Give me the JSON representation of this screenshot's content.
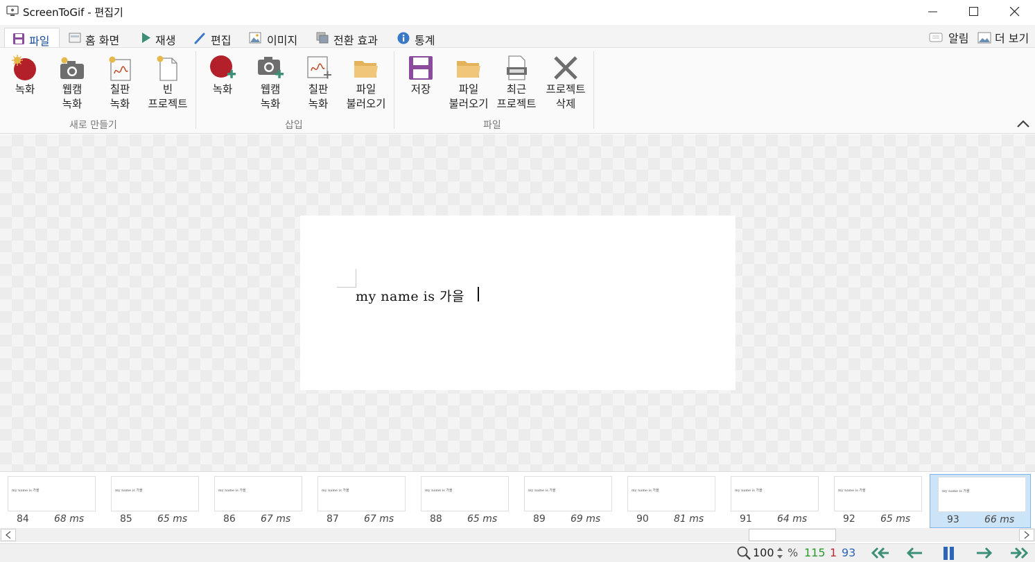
{
  "window": {
    "title": "ScreenToGif - 편집기",
    "minimize_icon": "minimize-icon",
    "maximize_icon": "maximize-icon",
    "close_icon": "close-icon"
  },
  "tabs": [
    {
      "label": "파일",
      "icon": "floppy-icon",
      "active": true
    },
    {
      "label": "홈 화면",
      "icon": "home-icon",
      "active": false
    },
    {
      "label": "재생",
      "icon": "play-icon",
      "active": false
    },
    {
      "label": "편집",
      "icon": "pencil-icon",
      "active": false
    },
    {
      "label": "이미지",
      "icon": "image-icon",
      "active": false
    },
    {
      "label": "전환 효과",
      "icon": "transition-icon",
      "active": false
    },
    {
      "label": "통계",
      "icon": "info-icon",
      "active": false
    }
  ],
  "right_links": {
    "notifications": "알림",
    "more": "더 보기"
  },
  "ribbon": {
    "groups": [
      {
        "label": "새로 만들기",
        "buttons": [
          {
            "label": "녹화",
            "icon": "record-icon"
          },
          {
            "label": "웹캠\n녹화",
            "icon": "webcam-icon"
          },
          {
            "label": "칠판\n녹화",
            "icon": "board-icon"
          },
          {
            "label": "빈\n프로젝트",
            "icon": "blank-project-icon"
          }
        ]
      },
      {
        "label": "삽입",
        "buttons": [
          {
            "label": "녹화",
            "icon": "record-add-icon"
          },
          {
            "label": "웹캠\n녹화",
            "icon": "webcam-add-icon"
          },
          {
            "label": "칠판\n녹화",
            "icon": "board-add-icon"
          },
          {
            "label": "파일\n불러오기",
            "icon": "folder-icon"
          }
        ]
      },
      {
        "label": "파일",
        "buttons": [
          {
            "label": "저장",
            "icon": "save-icon"
          },
          {
            "label": "파일\n불러오기",
            "icon": "folder-icon"
          },
          {
            "label": "최근\n프로젝트",
            "icon": "recent-projects-icon"
          },
          {
            "label": "프로젝트\n삭제",
            "icon": "delete-project-icon"
          }
        ]
      }
    ],
    "collapse_icon": "chevron-up-icon"
  },
  "canvas": {
    "frame_text": "my name is 가을"
  },
  "frames": [
    {
      "number": "84",
      "delay": "68 ms",
      "text": "my name is 가을"
    },
    {
      "number": "85",
      "delay": "65 ms",
      "text": "my name is 가을"
    },
    {
      "number": "86",
      "delay": "67 ms",
      "text": "my name is 가을"
    },
    {
      "number": "87",
      "delay": "67 ms",
      "text": "my name is 가을"
    },
    {
      "number": "88",
      "delay": "65 ms",
      "text": "my name is 가을"
    },
    {
      "number": "89",
      "delay": "69 ms",
      "text": "my name is 가을"
    },
    {
      "number": "90",
      "delay": "81 ms",
      "text": "my name is 가을"
    },
    {
      "number": "91",
      "delay": "64 ms",
      "text": "my name is 가을"
    },
    {
      "number": "92",
      "delay": "65 ms",
      "text": "my name is 가을"
    },
    {
      "number": "93",
      "delay": "66 ms",
      "text": "my name is 가을",
      "selected": true
    }
  ],
  "status": {
    "zoom": "100",
    "zoom_unit": "%",
    "total_frames": "115",
    "selected_count": "1",
    "current_frame": "93",
    "colors": {
      "total": "#2a9a2a",
      "selected": "#c0282d",
      "current": "#2c66b8",
      "nav": "#3c8f77"
    }
  }
}
